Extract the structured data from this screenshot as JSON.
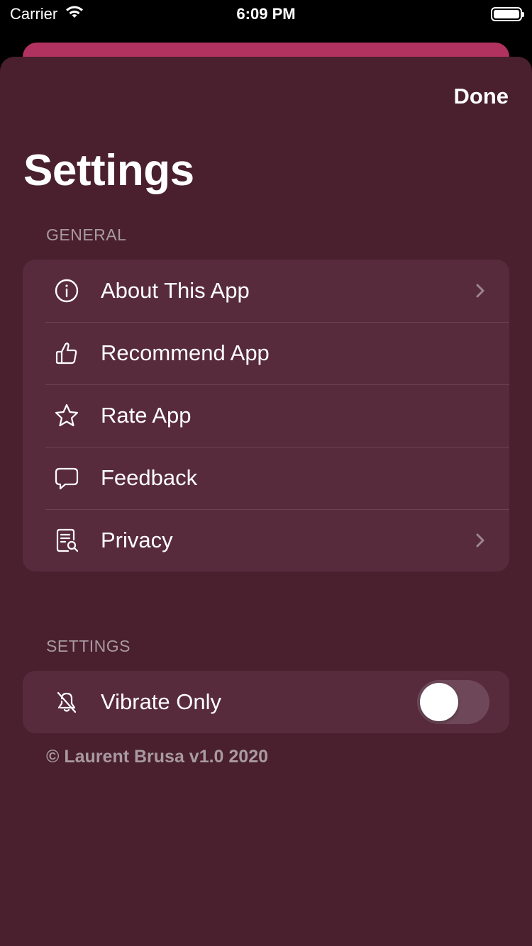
{
  "status_bar": {
    "carrier": "Carrier",
    "time": "6:09 PM",
    "battery_level": 1.0
  },
  "header": {
    "done_label": "Done",
    "title": "Settings"
  },
  "general": {
    "header": "GENERAL",
    "items": [
      {
        "label": "About This App",
        "icon": "info-circle-icon",
        "chevron": true
      },
      {
        "label": "Recommend App",
        "icon": "thumbs-up-icon",
        "chevron": false
      },
      {
        "label": "Rate App",
        "icon": "star-icon",
        "chevron": false
      },
      {
        "label": "Feedback",
        "icon": "speech-bubble-icon",
        "chevron": false
      },
      {
        "label": "Privacy",
        "icon": "document-search-icon",
        "chevron": true
      }
    ]
  },
  "settings": {
    "header": "SETTINGS",
    "vibrate_label": "Vibrate Only",
    "vibrate_icon": "bell-slash-icon",
    "vibrate_on": false
  },
  "footer": {
    "text": "© Laurent Brusa v1.0 2020"
  },
  "colors": {
    "sheet_background": "#4a1f2e",
    "group_background": "#582b3c",
    "accent_card": "#b2325f",
    "secondary_text": "#a89aa0"
  }
}
